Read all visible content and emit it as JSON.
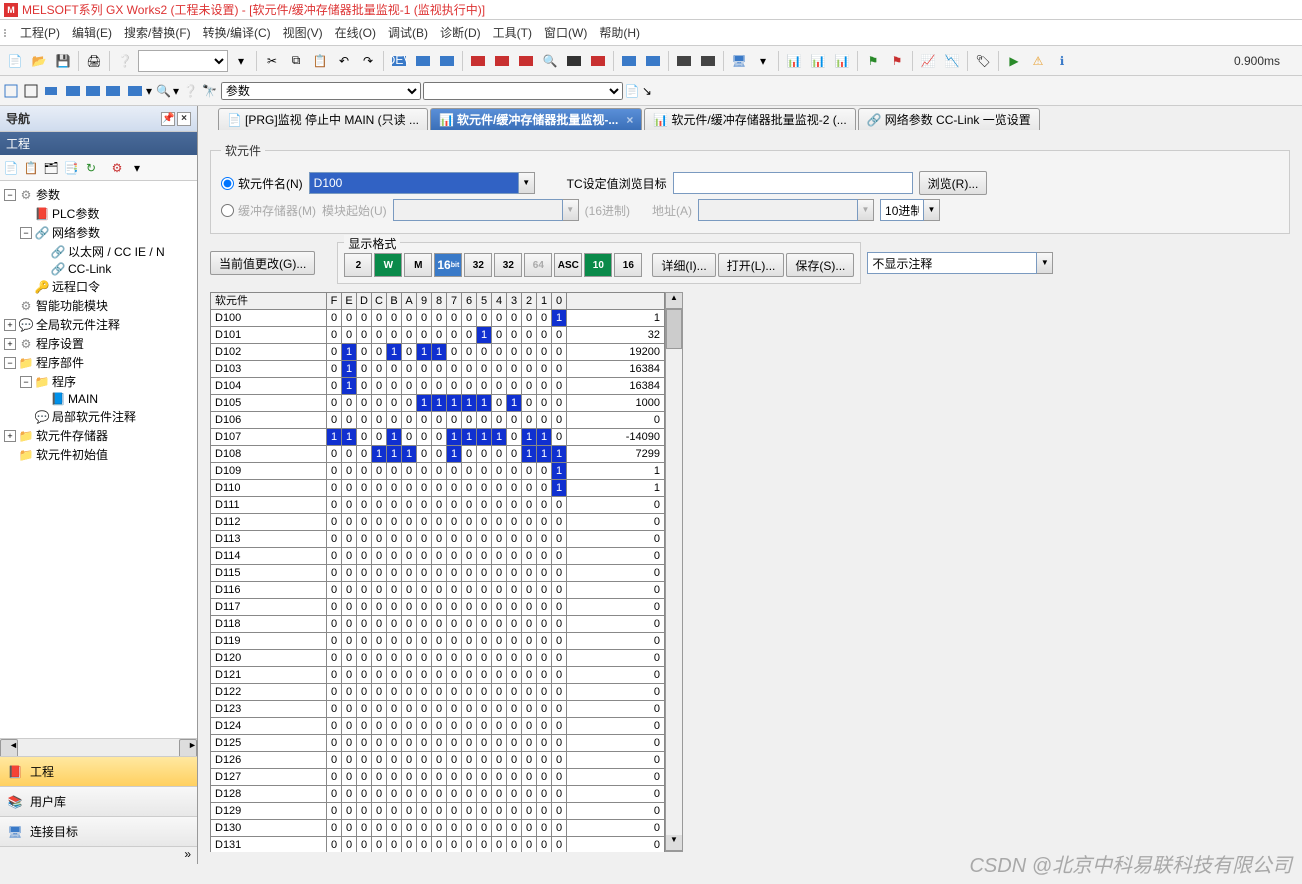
{
  "app": {
    "title": "MELSOFT系列 GX Works2 (工程未设置) - [软元件/缓冲存储器批量监视-1 (监视执行中)]"
  },
  "menu": {
    "file": "工程(P)",
    "edit": "编辑(E)",
    "search": "搜索/替换(F)",
    "convert": "转换/编译(C)",
    "view": "视图(V)",
    "online": "在线(O)",
    "debug": "调试(B)",
    "diag": "诊断(D)",
    "tool": "工具(T)",
    "window": "窗口(W)",
    "help": "帮助(H)"
  },
  "timer": "0.900ms",
  "combo2": "参数",
  "nav": {
    "title": "导航",
    "sub": "工程",
    "tree": {
      "params": "参数",
      "plc": "PLC参数",
      "net": "网络参数",
      "eth": "以太网 / CC IE / N",
      "cclink": "CC-Link",
      "remote": "远程口令",
      "smart": "智能功能模块",
      "globalcmt": "全局软元件注释",
      "progset": "程序设置",
      "progpart": "程序部件",
      "prog": "程序",
      "main": "MAIN",
      "localcmt": "局部软元件注释",
      "devmem": "软元件存储器",
      "devinit": "软元件初始值"
    },
    "tabs": {
      "project": "工程",
      "userlib": "用户库",
      "conn": "连接目标"
    }
  },
  "doctabs": {
    "t1": "[PRG]监视 停止中 MAIN (只读 ...",
    "t2": "软元件/缓冲存储器批量监视-...",
    "t3": "软元件/缓冲存储器批量监视-2 (...",
    "t4": "网络参数  CC-Link 一览设置"
  },
  "device_section": {
    "legend": "软元件",
    "radio_name": "软元件名(N)",
    "radio_buf": "缓冲存储器(M)",
    "device_val": "D100",
    "tc_label": "TC设定值浏览目标",
    "browse": "浏览(R)...",
    "module_start": "模块起始(U)",
    "hex": "(16进制)",
    "addr": "地址(A)",
    "dec": "10进制"
  },
  "actions": {
    "change": "当前值更改(G)...",
    "detail": "详细(I)...",
    "open": "打开(L)...",
    "save": "保存(S)...",
    "annot": "不显示注释"
  },
  "format": {
    "legend": "显示格式",
    "b2": "2",
    "bW": "W",
    "bM": "M",
    "b16b": "16",
    "b32": "32",
    "b32b": "32",
    "b64": "64",
    "bASC": "ASC",
    "b10": "10",
    "b16": "16"
  },
  "grid": {
    "hdr_device": "软元件",
    "bit_cols": [
      "F",
      "E",
      "D",
      "C",
      "B",
      "A",
      "9",
      "8",
      "7",
      "6",
      "5",
      "4",
      "3",
      "2",
      "1",
      "0"
    ],
    "rows": [
      {
        "d": "D100",
        "b": [
          0,
          0,
          0,
          0,
          0,
          0,
          0,
          0,
          0,
          0,
          0,
          0,
          0,
          0,
          0,
          1
        ],
        "v": "1"
      },
      {
        "d": "D101",
        "b": [
          0,
          0,
          0,
          0,
          0,
          0,
          0,
          0,
          0,
          0,
          1,
          0,
          0,
          0,
          0,
          0
        ],
        "v": "32"
      },
      {
        "d": "D102",
        "b": [
          0,
          1,
          0,
          0,
          1,
          0,
          1,
          1,
          0,
          0,
          0,
          0,
          0,
          0,
          0,
          0
        ],
        "v": "19200"
      },
      {
        "d": "D103",
        "b": [
          0,
          1,
          0,
          0,
          0,
          0,
          0,
          0,
          0,
          0,
          0,
          0,
          0,
          0,
          0,
          0
        ],
        "v": "16384"
      },
      {
        "d": "D104",
        "b": [
          0,
          1,
          0,
          0,
          0,
          0,
          0,
          0,
          0,
          0,
          0,
          0,
          0,
          0,
          0,
          0
        ],
        "v": "16384"
      },
      {
        "d": "D105",
        "b": [
          0,
          0,
          0,
          0,
          0,
          0,
          1,
          1,
          1,
          1,
          1,
          0,
          1,
          0,
          0,
          0
        ],
        "v": "1000"
      },
      {
        "d": "D106",
        "b": [
          0,
          0,
          0,
          0,
          0,
          0,
          0,
          0,
          0,
          0,
          0,
          0,
          0,
          0,
          0,
          0
        ],
        "v": "0"
      },
      {
        "d": "D107",
        "b": [
          1,
          1,
          0,
          0,
          1,
          0,
          0,
          0,
          1,
          1,
          1,
          1,
          0,
          1,
          1,
          0
        ],
        "v": "-14090"
      },
      {
        "d": "D108",
        "b": [
          0,
          0,
          0,
          1,
          1,
          1,
          0,
          0,
          1,
          0,
          0,
          0,
          0,
          1,
          1,
          1
        ],
        "v": "7299"
      },
      {
        "d": "D109",
        "b": [
          0,
          0,
          0,
          0,
          0,
          0,
          0,
          0,
          0,
          0,
          0,
          0,
          0,
          0,
          0,
          1
        ],
        "v": "1"
      },
      {
        "d": "D110",
        "b": [
          0,
          0,
          0,
          0,
          0,
          0,
          0,
          0,
          0,
          0,
          0,
          0,
          0,
          0,
          0,
          1
        ],
        "v": "1"
      },
      {
        "d": "D111",
        "b": [
          0,
          0,
          0,
          0,
          0,
          0,
          0,
          0,
          0,
          0,
          0,
          0,
          0,
          0,
          0,
          0
        ],
        "v": "0"
      },
      {
        "d": "D112",
        "b": [
          0,
          0,
          0,
          0,
          0,
          0,
          0,
          0,
          0,
          0,
          0,
          0,
          0,
          0,
          0,
          0
        ],
        "v": "0"
      },
      {
        "d": "D113",
        "b": [
          0,
          0,
          0,
          0,
          0,
          0,
          0,
          0,
          0,
          0,
          0,
          0,
          0,
          0,
          0,
          0
        ],
        "v": "0"
      },
      {
        "d": "D114",
        "b": [
          0,
          0,
          0,
          0,
          0,
          0,
          0,
          0,
          0,
          0,
          0,
          0,
          0,
          0,
          0,
          0
        ],
        "v": "0"
      },
      {
        "d": "D115",
        "b": [
          0,
          0,
          0,
          0,
          0,
          0,
          0,
          0,
          0,
          0,
          0,
          0,
          0,
          0,
          0,
          0
        ],
        "v": "0"
      },
      {
        "d": "D116",
        "b": [
          0,
          0,
          0,
          0,
          0,
          0,
          0,
          0,
          0,
          0,
          0,
          0,
          0,
          0,
          0,
          0
        ],
        "v": "0"
      },
      {
        "d": "D117",
        "b": [
          0,
          0,
          0,
          0,
          0,
          0,
          0,
          0,
          0,
          0,
          0,
          0,
          0,
          0,
          0,
          0
        ],
        "v": "0"
      },
      {
        "d": "D118",
        "b": [
          0,
          0,
          0,
          0,
          0,
          0,
          0,
          0,
          0,
          0,
          0,
          0,
          0,
          0,
          0,
          0
        ],
        "v": "0"
      },
      {
        "d": "D119",
        "b": [
          0,
          0,
          0,
          0,
          0,
          0,
          0,
          0,
          0,
          0,
          0,
          0,
          0,
          0,
          0,
          0
        ],
        "v": "0"
      },
      {
        "d": "D120",
        "b": [
          0,
          0,
          0,
          0,
          0,
          0,
          0,
          0,
          0,
          0,
          0,
          0,
          0,
          0,
          0,
          0
        ],
        "v": "0"
      },
      {
        "d": "D121",
        "b": [
          0,
          0,
          0,
          0,
          0,
          0,
          0,
          0,
          0,
          0,
          0,
          0,
          0,
          0,
          0,
          0
        ],
        "v": "0"
      },
      {
        "d": "D122",
        "b": [
          0,
          0,
          0,
          0,
          0,
          0,
          0,
          0,
          0,
          0,
          0,
          0,
          0,
          0,
          0,
          0
        ],
        "v": "0"
      },
      {
        "d": "D123",
        "b": [
          0,
          0,
          0,
          0,
          0,
          0,
          0,
          0,
          0,
          0,
          0,
          0,
          0,
          0,
          0,
          0
        ],
        "v": "0"
      },
      {
        "d": "D124",
        "b": [
          0,
          0,
          0,
          0,
          0,
          0,
          0,
          0,
          0,
          0,
          0,
          0,
          0,
          0,
          0,
          0
        ],
        "v": "0"
      },
      {
        "d": "D125",
        "b": [
          0,
          0,
          0,
          0,
          0,
          0,
          0,
          0,
          0,
          0,
          0,
          0,
          0,
          0,
          0,
          0
        ],
        "v": "0"
      },
      {
        "d": "D126",
        "b": [
          0,
          0,
          0,
          0,
          0,
          0,
          0,
          0,
          0,
          0,
          0,
          0,
          0,
          0,
          0,
          0
        ],
        "v": "0"
      },
      {
        "d": "D127",
        "b": [
          0,
          0,
          0,
          0,
          0,
          0,
          0,
          0,
          0,
          0,
          0,
          0,
          0,
          0,
          0,
          0
        ],
        "v": "0"
      },
      {
        "d": "D128",
        "b": [
          0,
          0,
          0,
          0,
          0,
          0,
          0,
          0,
          0,
          0,
          0,
          0,
          0,
          0,
          0,
          0
        ],
        "v": "0"
      },
      {
        "d": "D129",
        "b": [
          0,
          0,
          0,
          0,
          0,
          0,
          0,
          0,
          0,
          0,
          0,
          0,
          0,
          0,
          0,
          0
        ],
        "v": "0"
      },
      {
        "d": "D130",
        "b": [
          0,
          0,
          0,
          0,
          0,
          0,
          0,
          0,
          0,
          0,
          0,
          0,
          0,
          0,
          0,
          0
        ],
        "v": "0"
      },
      {
        "d": "D131",
        "b": [
          0,
          0,
          0,
          0,
          0,
          0,
          0,
          0,
          0,
          0,
          0,
          0,
          0,
          0,
          0,
          0
        ],
        "v": "0"
      }
    ]
  },
  "watermark": "CSDN @北京中科易联科技有限公司"
}
